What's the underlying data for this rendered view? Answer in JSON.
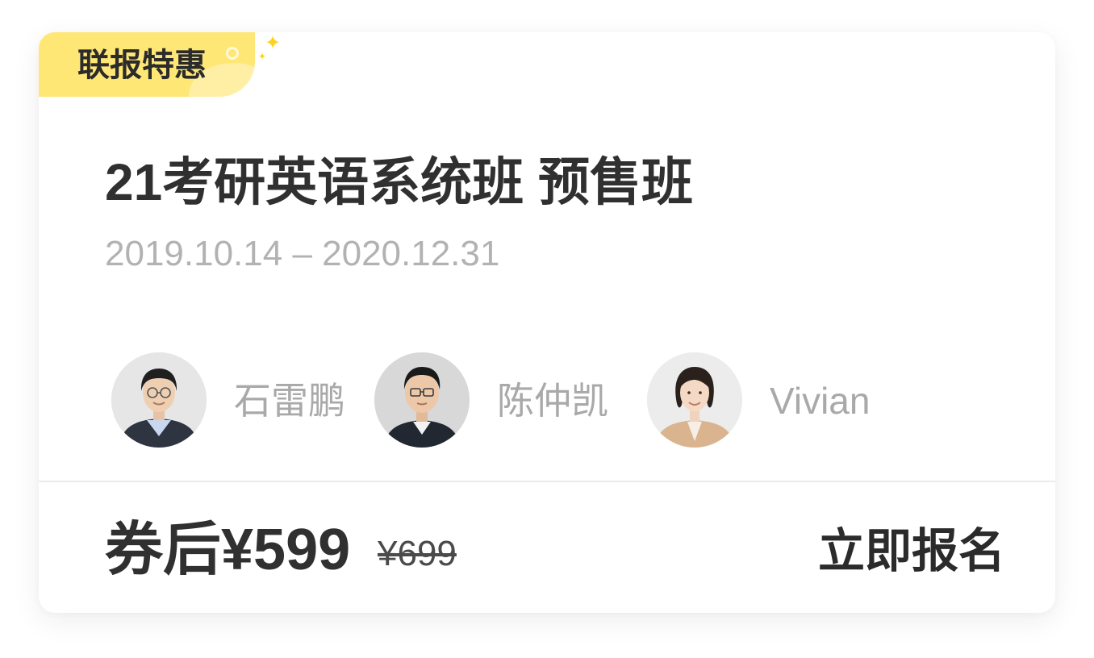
{
  "course_card": {
    "badge": "联报特惠",
    "title": "21考研英语系统班 预售班",
    "date_range": "2019.10.14 – 2020.12.31",
    "teachers": [
      {
        "name": "石雷鹏",
        "avatar_icon": "teacher-avatar-photo"
      },
      {
        "name": "陈仲凯",
        "avatar_icon": "teacher-avatar-photo"
      },
      {
        "name": "Vivian",
        "avatar_icon": "teacher-avatar-photo"
      }
    ],
    "price_label": "券后¥599",
    "original_price": "¥699",
    "enroll_label": "立即报名"
  },
  "colors": {
    "badge_background": "#ffe776",
    "sparkle": "#ffd21f",
    "title_text": "#303030",
    "muted_text": "#b2b2b2"
  }
}
